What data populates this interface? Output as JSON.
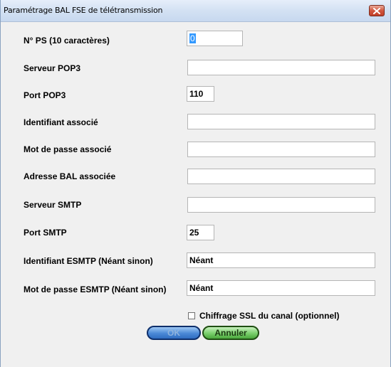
{
  "window": {
    "title": "Paramétrage BAL FSE de télétransmission"
  },
  "fields": [
    {
      "label": "N° PS (10 caractères)",
      "value": "0",
      "placeholder": ""
    },
    {
      "label": "Serveur POP3",
      "value": "",
      "placeholder": ""
    },
    {
      "label": "Port POP3",
      "value": "110",
      "placeholder": ""
    },
    {
      "label": "Identifiant associé",
      "value": "",
      "placeholder": ""
    },
    {
      "label": "Mot de passe associé",
      "value": "",
      "placeholder": ""
    },
    {
      "label": "Adresse BAL associée",
      "value": "",
      "placeholder": ""
    },
    {
      "label": "Serveur SMTP",
      "value": "",
      "placeholder": ""
    },
    {
      "label": "Port SMTP",
      "value": "25",
      "placeholder": ""
    },
    {
      "label": "Identifiant ESMTP  (Néant sinon)",
      "value": "Néant",
      "placeholder": ""
    },
    {
      "label": "Mot de passe ESMTP  (Néant sinon)",
      "value": "Néant",
      "placeholder": ""
    }
  ],
  "ssl_checkbox": {
    "label": "Chiffrage SSL du canal (optionnel)",
    "checked": false
  },
  "buttons": {
    "ok_label": "OK",
    "cancel_label": "Annuler"
  },
  "colors": {
    "selection": "#3399ff",
    "titlebar": "#d3e1f3",
    "close_button": "#c1402a",
    "ok_button": "#4a88d6",
    "cancel_button": "#79cf6b"
  },
  "icons": {
    "close": "close-icon"
  }
}
